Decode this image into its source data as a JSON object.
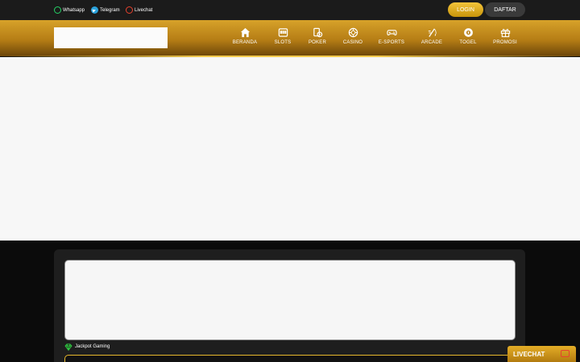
{
  "topbar": {
    "contacts": [
      {
        "label": "Whatsapp",
        "icon": "whatsapp-icon"
      },
      {
        "label": "Telegram",
        "icon": "telegram-icon"
      },
      {
        "label": "Livechat",
        "icon": "livechat-icon"
      }
    ],
    "login_label": "LOGIN",
    "daftar_label": "DAFTAR"
  },
  "nav": {
    "items": [
      {
        "label": "BERANDA",
        "icon": "home-icon"
      },
      {
        "label": "SLOTS",
        "icon": "slot-machine-icon"
      },
      {
        "label": "POKER",
        "icon": "poker-cards-icon"
      },
      {
        "label": "CASINO",
        "icon": "roulette-icon"
      },
      {
        "label": "E-SPORTS",
        "icon": "gamepad-icon"
      },
      {
        "label": "ARCADE",
        "icon": "fishing-rod-icon"
      },
      {
        "label": "TOGEL",
        "icon": "lottery-ball-icon"
      },
      {
        "label": "PROMOSI",
        "icon": "gift-icon"
      }
    ]
  },
  "jackpot": {
    "label": "Jackpot Gaming",
    "icon": "diamond-icon"
  },
  "floating": {
    "livechat_label": "LIVECHAT"
  },
  "colors": {
    "gold": "#d7a22a",
    "login": "#f4c43a",
    "whatsapp": "#25d366",
    "telegram": "#2aa2dc",
    "livechat": "#e8422e"
  }
}
